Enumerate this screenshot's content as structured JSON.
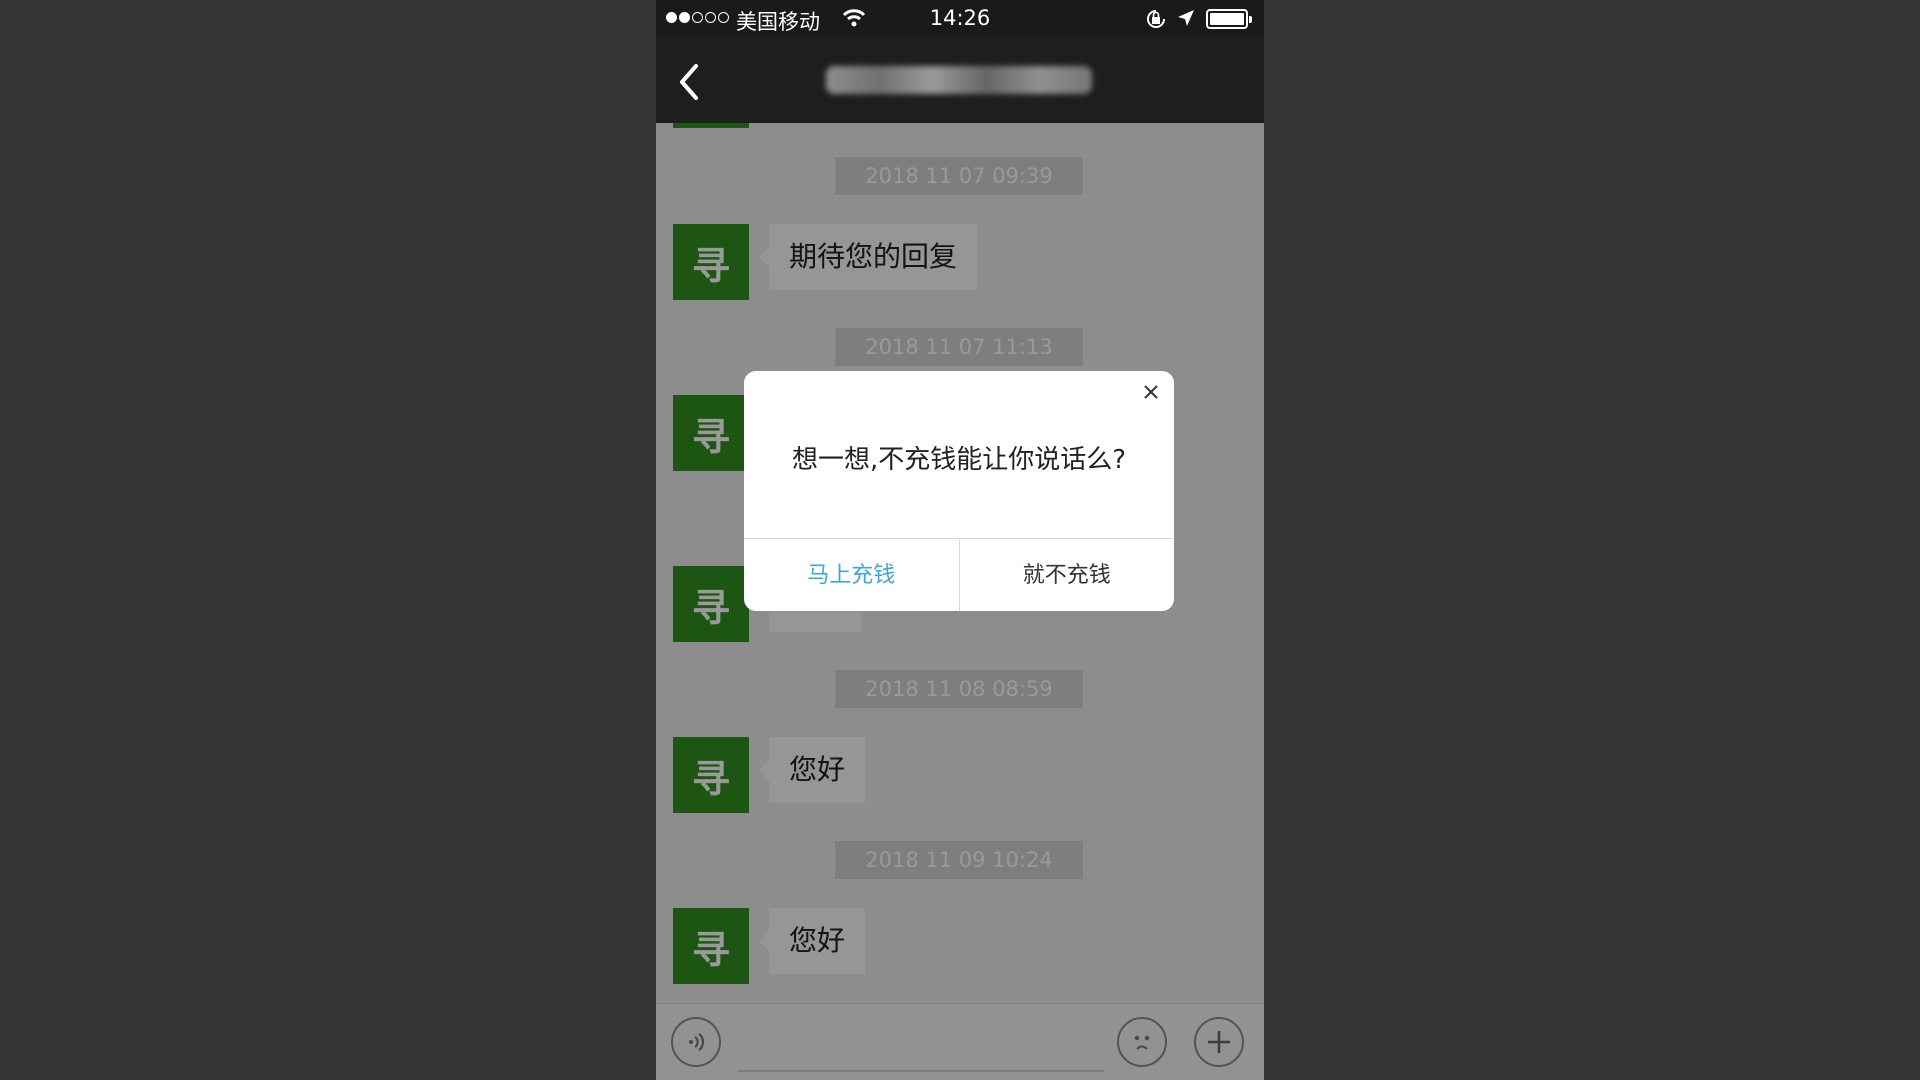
{
  "status_bar": {
    "carrier": "美国移动",
    "time": "14:26",
    "signal_bars": 2,
    "signal_total": 5
  },
  "nav": {
    "back_icon": "chevron-left-icon",
    "title_blurred": true
  },
  "chat": {
    "avatar_char": "寻",
    "messages": [
      {
        "timestamp": "2018 11 07 09:39",
        "text": "期待您的回复"
      },
      {
        "timestamp": "2018 11 07 11:13",
        "text": ""
      },
      {
        "timestamp": "",
        "text": ""
      },
      {
        "timestamp": "2018 11 08 08:59",
        "text": "您好"
      },
      {
        "timestamp": "2018 11 09 10:24",
        "text": "您好"
      }
    ]
  },
  "input_bar": {
    "voice_icon": "voice-icon",
    "emoji_icon": "emoji-face-icon",
    "plus_icon": "plus-icon",
    "text_value": ""
  },
  "dialog": {
    "message": "想一想,不充钱能让你说话么?",
    "primary_label": "马上充钱",
    "secondary_label": "就不充钱",
    "close_icon": "close-icon"
  },
  "colors": {
    "avatar": "#2f8f1f",
    "primary_action": "#3aa7e0",
    "header": "#1e1e1e"
  }
}
